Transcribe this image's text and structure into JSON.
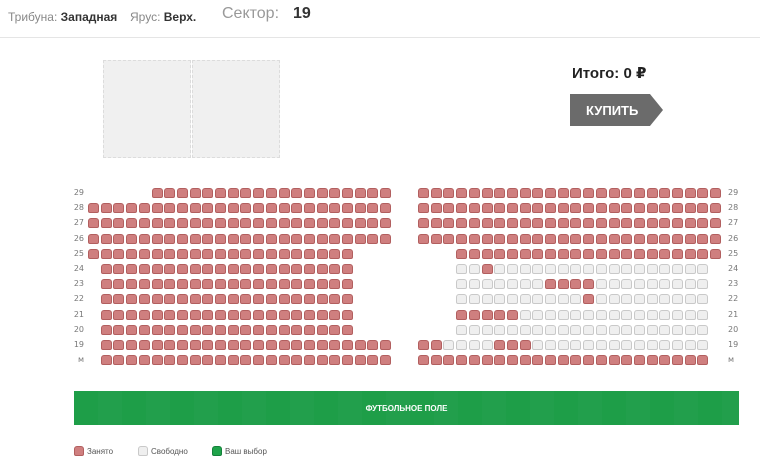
{
  "header": {
    "tribune_label": "Трибуна:",
    "tribune_value": "Западная",
    "tier_label": "Ярус:",
    "tier_value": "Верх.",
    "sector_label": "Сектор:",
    "sector_value": "19"
  },
  "summary": {
    "total_label": "Итого: 0 ₽",
    "buy_label": "КУПИТЬ"
  },
  "field_label": "ФУТБОЛЬНОЕ ПОЛЕ",
  "legend": {
    "occupied": "Занято",
    "free": "Свободно",
    "selected": "Ваш выбор"
  },
  "colors": {
    "occupied": "#cf7f7f",
    "free": "#efefef",
    "selected": "#1fa34a",
    "button": "#6b6b6b"
  },
  "rows": [
    {
      "label": "29",
      "left": {
        "free": [],
        "count_occ": 19,
        "start": 5
      },
      "right": {
        "count": 24,
        "free": []
      }
    },
    {
      "label": "28",
      "left": {
        "free": [],
        "count_occ": 24,
        "start": 0
      },
      "right": {
        "count": 24,
        "free": []
      }
    },
    {
      "label": "27",
      "left": {
        "free": [],
        "count_occ": 24,
        "start": 0
      },
      "right": {
        "count": 24,
        "free": []
      }
    },
    {
      "label": "26",
      "left": {
        "free": [],
        "count_occ": 24,
        "start": 0
      },
      "right": {
        "count": 24,
        "free": []
      }
    },
    {
      "label": "25",
      "left": {
        "free": [],
        "count_occ": 21,
        "start": 0
      },
      "right": {
        "count": 21,
        "free": []
      }
    },
    {
      "label": "24",
      "left": {
        "free": [],
        "count_occ": 20,
        "start": 1
      },
      "right": {
        "count": 20,
        "occ": [
          2
        ]
      }
    },
    {
      "label": "23",
      "left": {
        "free": [],
        "count_occ": 20,
        "start": 1
      },
      "right": {
        "count": 20,
        "occ": [
          7,
          8,
          9,
          10
        ]
      }
    },
    {
      "label": "22",
      "left": {
        "free": [],
        "count_occ": 20,
        "start": 1
      },
      "right": {
        "count": 20,
        "occ": [
          10
        ]
      }
    },
    {
      "label": "21",
      "left": {
        "free": [],
        "count_occ": 20,
        "start": 1
      },
      "right": {
        "count": 20,
        "occ": [
          0,
          1,
          2,
          3,
          4
        ]
      }
    },
    {
      "label": "20",
      "left": {
        "free": [],
        "count_occ": 20,
        "start": 1
      },
      "right": {
        "count": 20,
        "occ": []
      }
    },
    {
      "label": "19",
      "left": {
        "free": [],
        "count_occ": 23,
        "start": 1
      },
      "right": {
        "count": 23,
        "occ": [
          0,
          1,
          6,
          7,
          8
        ]
      }
    },
    {
      "label": "м",
      "left": {
        "free": [],
        "count_occ": 23,
        "start": 1
      },
      "right": {
        "count": 23,
        "occ": "all"
      }
    }
  ]
}
